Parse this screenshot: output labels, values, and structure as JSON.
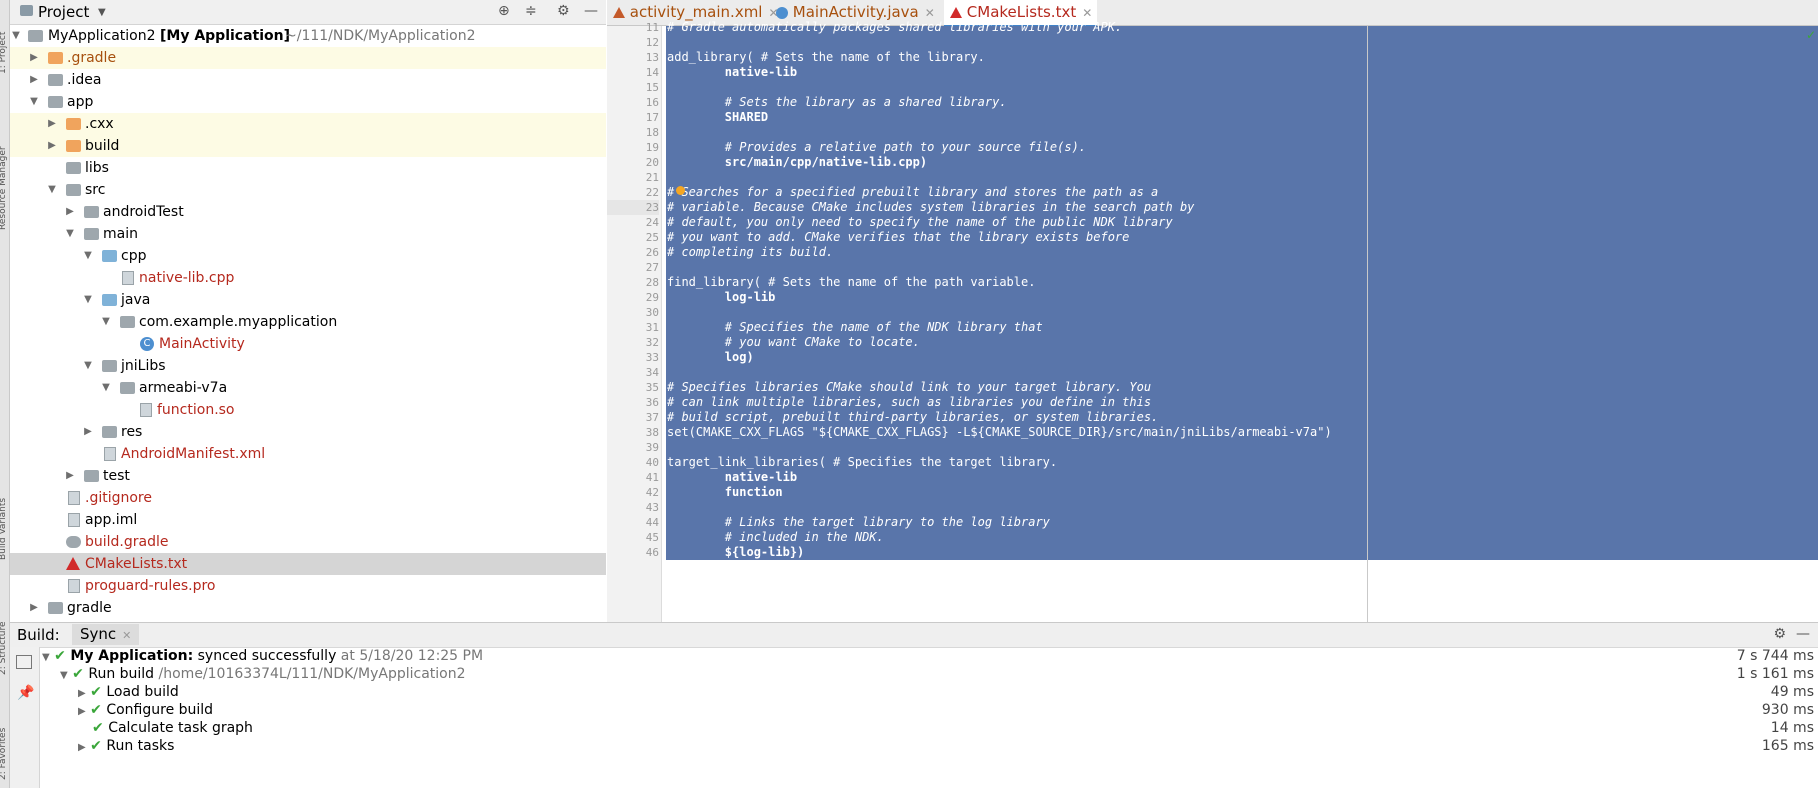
{
  "left_strip": {
    "tabs": [
      "1: Project",
      "Resource Manager",
      "Build Variants",
      "2: Structure",
      "2: Favorites"
    ]
  },
  "project_panel": {
    "title": "Project",
    "icons": [
      "locate-icon",
      "collapse-icon",
      "gear-icon",
      "minimize-icon"
    ],
    "root_name": "MyApplication2",
    "root_module": "[My Application]",
    "root_path": "~/111/NDK/MyApplication2",
    "items": [
      {
        "label": ".gradle"
      },
      {
        "label": ".idea"
      },
      {
        "label": "app"
      },
      {
        "label": ".cxx"
      },
      {
        "label": "build"
      },
      {
        "label": "libs"
      },
      {
        "label": "src"
      },
      {
        "label": "androidTest"
      },
      {
        "label": "main"
      },
      {
        "label": "cpp"
      },
      {
        "label": "native-lib.cpp"
      },
      {
        "label": "java"
      },
      {
        "label": "com.example.myapplication"
      },
      {
        "label": "MainActivity"
      },
      {
        "label": "jniLibs"
      },
      {
        "label": "armeabi-v7a"
      },
      {
        "label": "function.so"
      },
      {
        "label": "res"
      },
      {
        "label": "AndroidManifest.xml"
      },
      {
        "label": "test"
      },
      {
        "label": ".gitignore"
      },
      {
        "label": "app.iml"
      },
      {
        "label": "build.gradle"
      },
      {
        "label": "CMakeLists.txt"
      },
      {
        "label": "proguard-rules.pro"
      },
      {
        "label": "gradle"
      }
    ]
  },
  "editor": {
    "tabs": [
      {
        "label": "activity_main.xml"
      },
      {
        "label": "MainActivity.java"
      },
      {
        "label": "CMakeLists.txt"
      }
    ],
    "lines": [
      {
        "n": "11",
        "text": "# Gradle automatically packages shared libraries with your APK."
      },
      {
        "n": "12",
        "text": ""
      },
      {
        "n": "13",
        "text": "add_library( # Sets the name of the library."
      },
      {
        "n": "14",
        "text": "        native-lib"
      },
      {
        "n": "15",
        "text": ""
      },
      {
        "n": "16",
        "text": "        # Sets the library as a shared library."
      },
      {
        "n": "17",
        "text": "        SHARED"
      },
      {
        "n": "18",
        "text": ""
      },
      {
        "n": "19",
        "text": "        # Provides a relative path to your source file(s)."
      },
      {
        "n": "20",
        "text": "        src/main/cpp/native-lib.cpp)"
      },
      {
        "n": "21",
        "text": ""
      },
      {
        "n": "22",
        "text": "# Searches for a specified prebuilt library and stores the path as a"
      },
      {
        "n": "23",
        "text": "# variable. Because CMake includes system libraries in the search path by"
      },
      {
        "n": "24",
        "text": "# default, you only need to specify the name of the public NDK library"
      },
      {
        "n": "25",
        "text": "# you want to add. CMake verifies that the library exists before"
      },
      {
        "n": "26",
        "text": "# completing its build."
      },
      {
        "n": "27",
        "text": ""
      },
      {
        "n": "28",
        "text": "find_library( # Sets the name of the path variable."
      },
      {
        "n": "29",
        "text": "        log-lib"
      },
      {
        "n": "30",
        "text": ""
      },
      {
        "n": "31",
        "text": "        # Specifies the name of the NDK library that"
      },
      {
        "n": "32",
        "text": "        # you want CMake to locate."
      },
      {
        "n": "33",
        "text": "        log)"
      },
      {
        "n": "34",
        "text": ""
      },
      {
        "n": "35",
        "text": "# Specifies libraries CMake should link to your target library. You"
      },
      {
        "n": "36",
        "text": "# can link multiple libraries, such as libraries you define in this"
      },
      {
        "n": "37",
        "text": "# build script, prebuilt third-party libraries, or system libraries."
      },
      {
        "n": "38",
        "text": "set(CMAKE_CXX_FLAGS \"${CMAKE_CXX_FLAGS} -L${CMAKE_SOURCE_DIR}/src/main/jniLibs/armeabi-v7a\")"
      },
      {
        "n": "39",
        "text": ""
      },
      {
        "n": "40",
        "text": "target_link_libraries( # Specifies the target library."
      },
      {
        "n": "41",
        "text": "        native-lib"
      },
      {
        "n": "42",
        "text": "        function"
      },
      {
        "n": "43",
        "text": ""
      },
      {
        "n": "44",
        "text": "        # Links the target library to the log library"
      },
      {
        "n": "45",
        "text": "        # included in the NDK."
      },
      {
        "n": "46",
        "text": "        ${log-lib})"
      }
    ]
  },
  "build_panel": {
    "label": "Build:",
    "tab": "Sync",
    "rows": [
      {
        "bold_text": "My Application:",
        "text": " synced successfully",
        "extra": " at 5/18/20 12:25 PM",
        "time": "7 s 744 ms"
      },
      {
        "bold_text": "",
        "text": "Run build",
        "extra": " /home/10163374L/111/NDK/MyApplication2",
        "time": "1 s 161 ms"
      },
      {
        "bold_text": "",
        "text": "Load build",
        "extra": "",
        "time": "49 ms"
      },
      {
        "bold_text": "",
        "text": "Configure build",
        "extra": "",
        "time": "930 ms"
      },
      {
        "bold_text": "",
        "text": "Calculate task graph",
        "extra": "",
        "time": "14 ms"
      },
      {
        "bold_text": "",
        "text": "Run tasks",
        "extra": "",
        "time": "165 ms"
      }
    ]
  }
}
